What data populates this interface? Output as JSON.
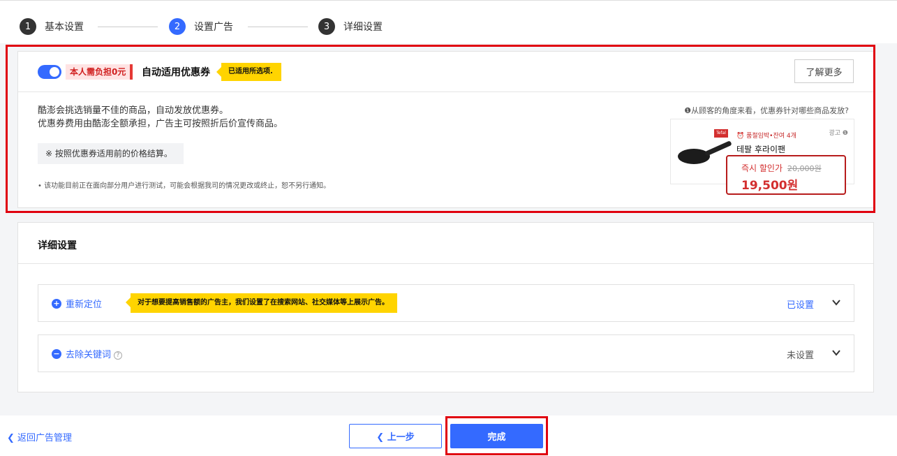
{
  "stepper": {
    "steps": [
      {
        "num": "1",
        "label": "基本设置"
      },
      {
        "num": "2",
        "label": "设置广告"
      },
      {
        "num": "3",
        "label": "详细设置"
      }
    ]
  },
  "coupon": {
    "badge": "本人需负担0元",
    "title": "自动适用优惠券",
    "applied_tag": "已适用所选项.",
    "learn_more": "了解更多",
    "desc_line1": "酷澎会挑选销量不佳的商品，自动发放优惠券。",
    "desc_line2": "优惠券费用由酷澎全额承担，广告主可按照折后价宣传商品。",
    "note": "※ 按照优惠券适用前的价格结算。",
    "fine_print": "• 该功能目前正在面向部分用户进行测试，可能会根据我司的情况更改或终止，恕不另行通知。",
    "preview_question": "❶从顾客的角度来看，优惠券针对哪些商品发放?",
    "preview": {
      "brand": "Tefal",
      "delivery": "⏰ 품절임박•잔여 4개",
      "ad_label": "광고 ❶",
      "product_name": "테팔 후라이팬",
      "discount_label": "즉시 할인가",
      "old_price": "20,000원",
      "new_price": "19,500원"
    }
  },
  "details": {
    "title": "详细设置",
    "rows": [
      {
        "icon": "+",
        "name": "重新定位",
        "tag": "对于想要提高销售额的广告主，我们设置了在搜索网站、社交媒体等上展示广告。",
        "status": "已设置",
        "status_color": "#346aff"
      },
      {
        "icon": "−",
        "name": "去除关键词",
        "help": "?",
        "status": "未设置",
        "status_color": "#555555"
      }
    ]
  },
  "footer": {
    "back_link": "❮ 返回广告管理",
    "prev_button": "❮  上一步",
    "done_button": "完成"
  },
  "colors": {
    "accent": "#346aff",
    "highlight": "#e0000f",
    "tag": "#ffd400"
  }
}
